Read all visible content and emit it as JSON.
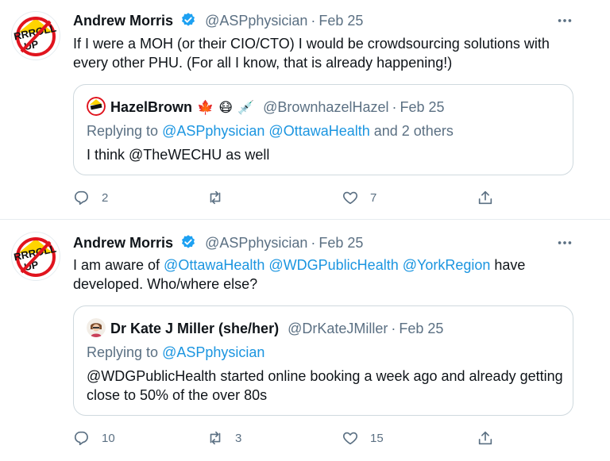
{
  "tweets": [
    {
      "author": "Andrew Morris",
      "handle": "@ASPphysician",
      "date": "Feb 25",
      "text": "If I were a MOH (or their CIO/CTO) I would be crowdsourcing solutions with every other PHU.  (For all I know, that is already happening!)",
      "quote": {
        "author": "HazelBrown",
        "emojis": [
          "🍁",
          "😷",
          "💉"
        ],
        "handle": "@BrownhazelHazel",
        "date": "Feb 25",
        "reply_prefix": "Replying to ",
        "reply_mentions": [
          "@ASPphysician",
          "@OttawaHealth"
        ],
        "reply_suffix": " and 2 others",
        "text": "I think @TheWECHU as well"
      },
      "actions": {
        "reply": "2",
        "retweet": "",
        "like": "7"
      }
    },
    {
      "author": "Andrew Morris",
      "handle": "@ASPphysician",
      "date": "Feb 25",
      "text_prefix": "I am aware of ",
      "text_mentions": [
        "@OttawaHealth",
        "@WDGPublicHealth",
        "@YorkRegion"
      ],
      "text_suffix": " have developed.  Who/where else?",
      "quote": {
        "author": "Dr Kate J Miller (she/her)",
        "handle": "@DrKateJMiller",
        "date": "Feb 25",
        "reply_prefix": "Replying to ",
        "reply_mentions": [
          "@ASPphysician"
        ],
        "text": "@WDGPublicHealth started online booking a week ago and already getting close to 50% of the over 80s"
      },
      "actions": {
        "reply": "10",
        "retweet": "3",
        "like": "15"
      }
    }
  ],
  "avatar_text": {
    "line1": "RRROLL",
    "line2": "UP"
  },
  "colors": {
    "link": "#1b95e0",
    "secondary": "#5b7083",
    "verified": "#1da1f2",
    "border": "#cfd9de"
  }
}
